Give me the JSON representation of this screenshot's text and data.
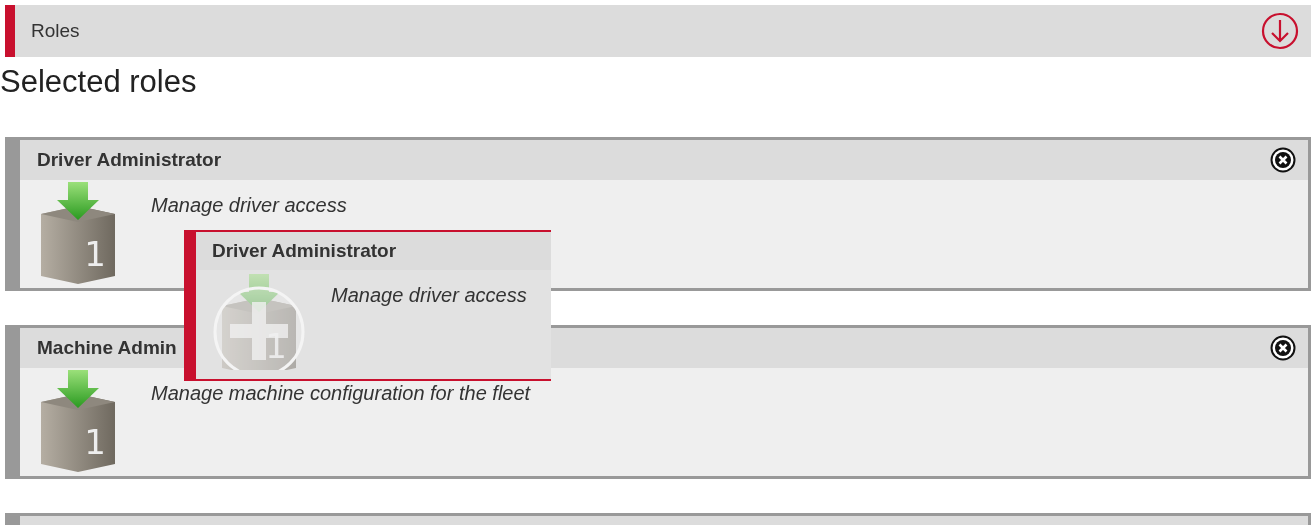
{
  "section": {
    "title": "Roles",
    "expanded": true
  },
  "heading": "Selected roles",
  "roles": [
    {
      "title": "Driver Administrator",
      "description": "Manage driver access",
      "icon_badge": "1"
    },
    {
      "title": "Machine Admin",
      "description": "Manage machine configuration for the fleet",
      "icon_badge": "1"
    }
  ],
  "more_below": true,
  "drag_preview": {
    "title": "Driver Administrator",
    "description": "Manage driver access",
    "icon_badge": "1"
  }
}
